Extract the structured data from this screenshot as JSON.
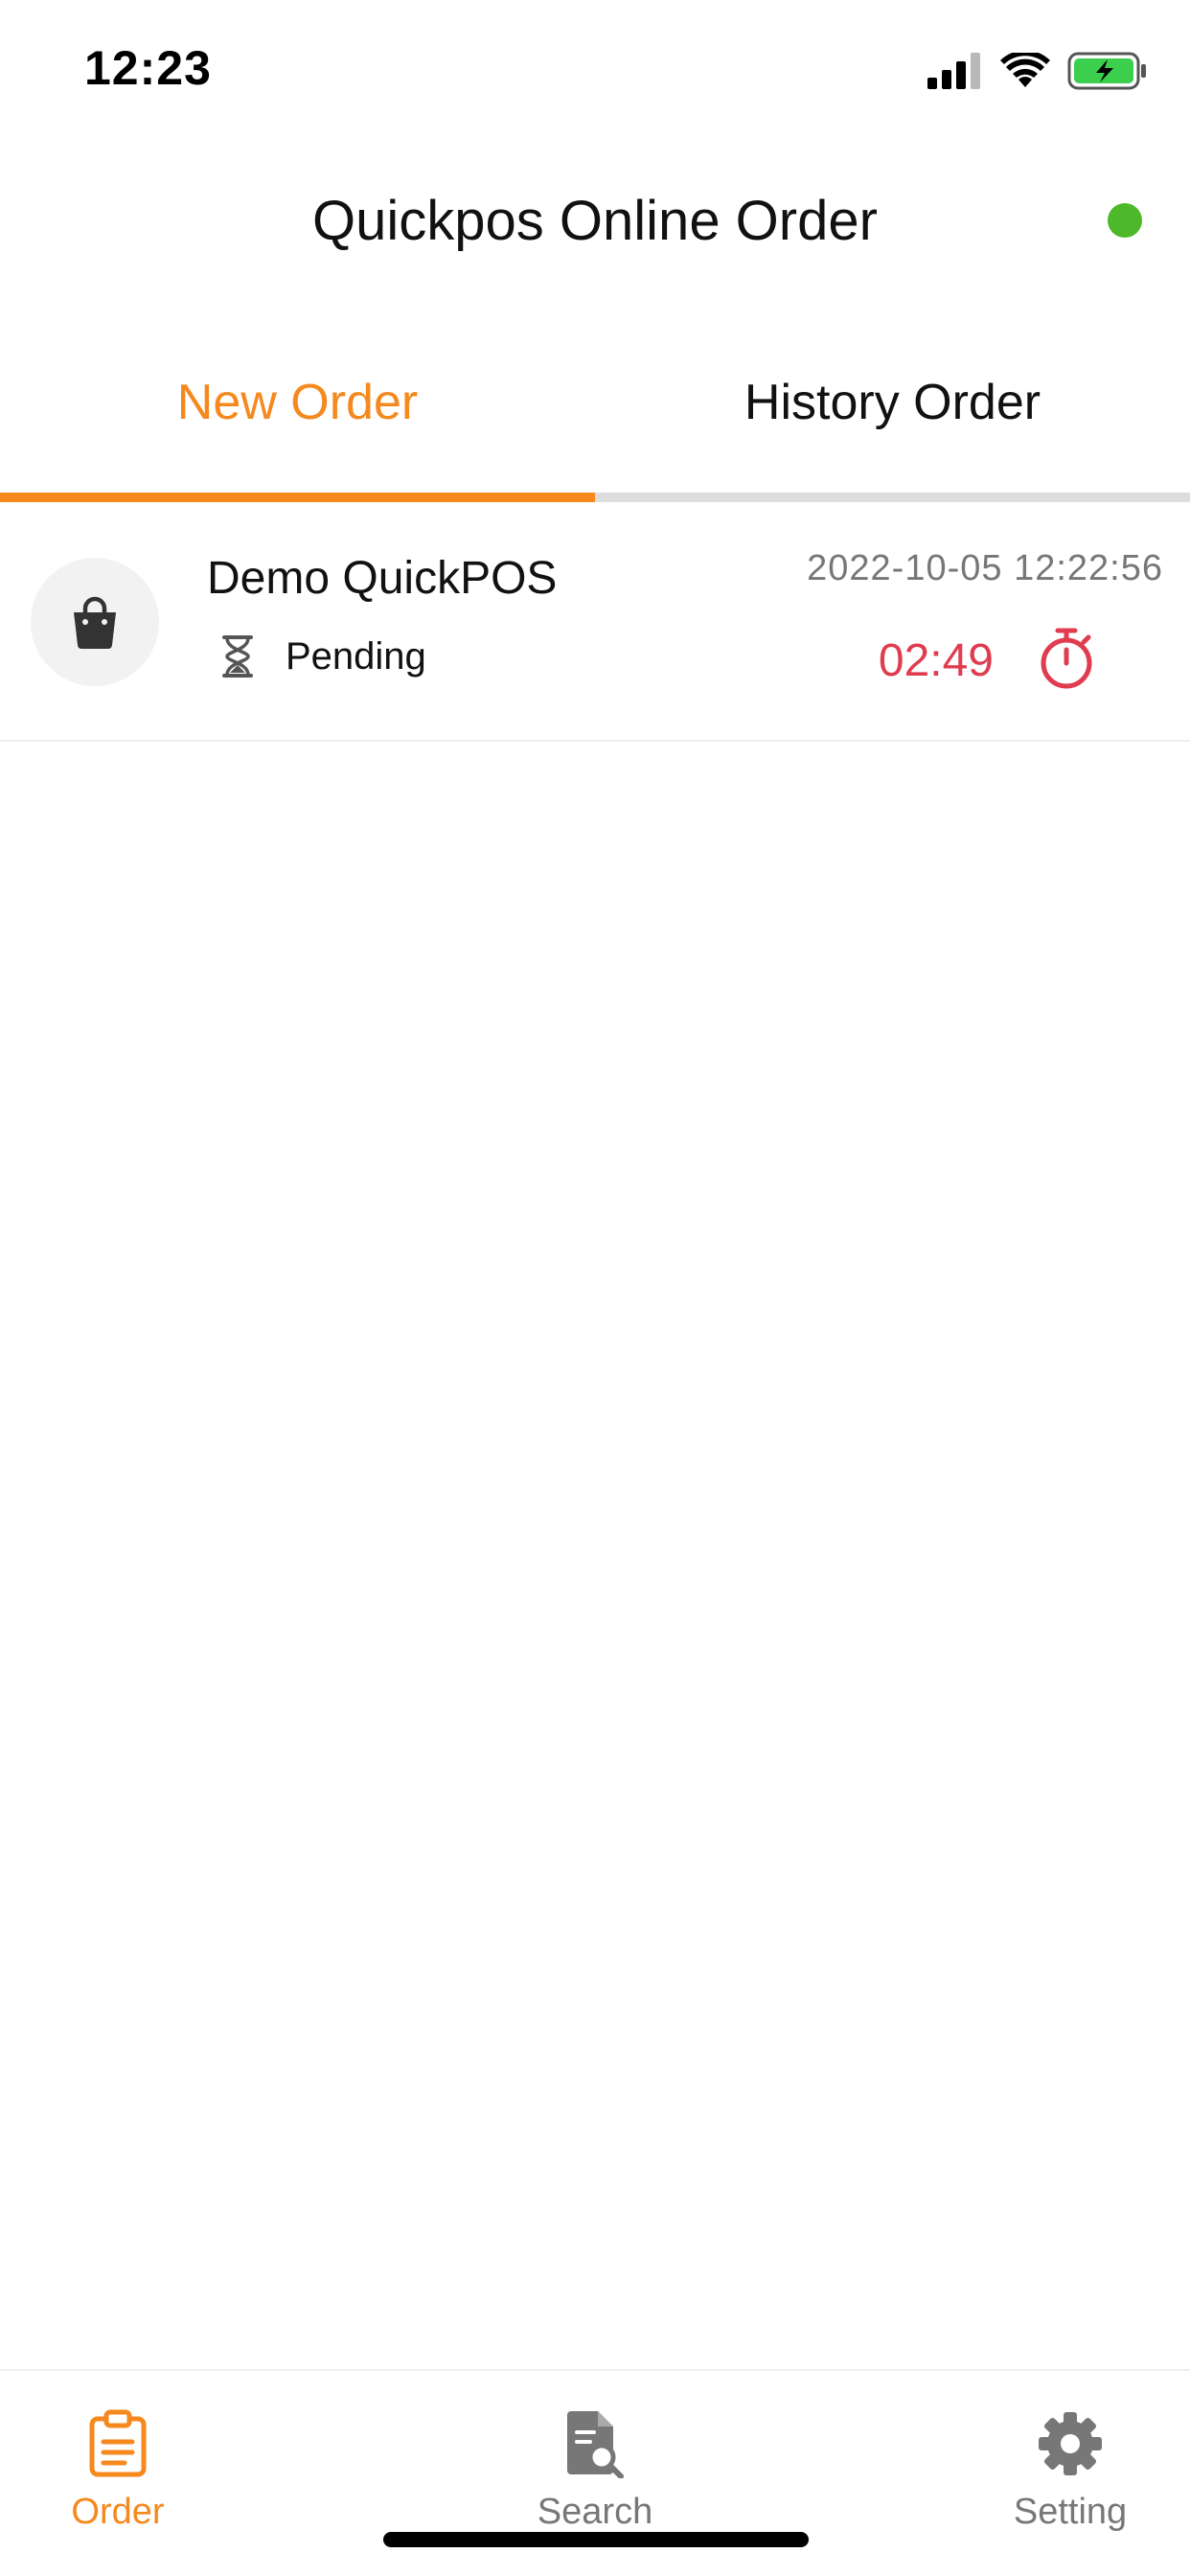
{
  "status_bar": {
    "time": "12:23"
  },
  "header": {
    "title": "Quickpos Online Order",
    "online_color": "#4cb82a"
  },
  "tabs": [
    {
      "label": "New Order",
      "active": true
    },
    {
      "label": "History Order",
      "active": false
    }
  ],
  "orders": [
    {
      "name": "Demo QuickPOS",
      "status": "Pending",
      "datetime": "2022-10-05 12:22:56",
      "countdown": "02:49",
      "icon": "shopping-bag-icon"
    }
  ],
  "bottom_nav": [
    {
      "label": "Order",
      "icon": "clipboard-icon",
      "active": true
    },
    {
      "label": "Search",
      "icon": "document-search-icon",
      "active": false
    },
    {
      "label": "Setting",
      "icon": "gear-icon",
      "active": false
    }
  ],
  "colors": {
    "accent": "#f5891e",
    "timer": "#e03c50",
    "online": "#4cb82a",
    "battery": "#3ccf4e"
  }
}
